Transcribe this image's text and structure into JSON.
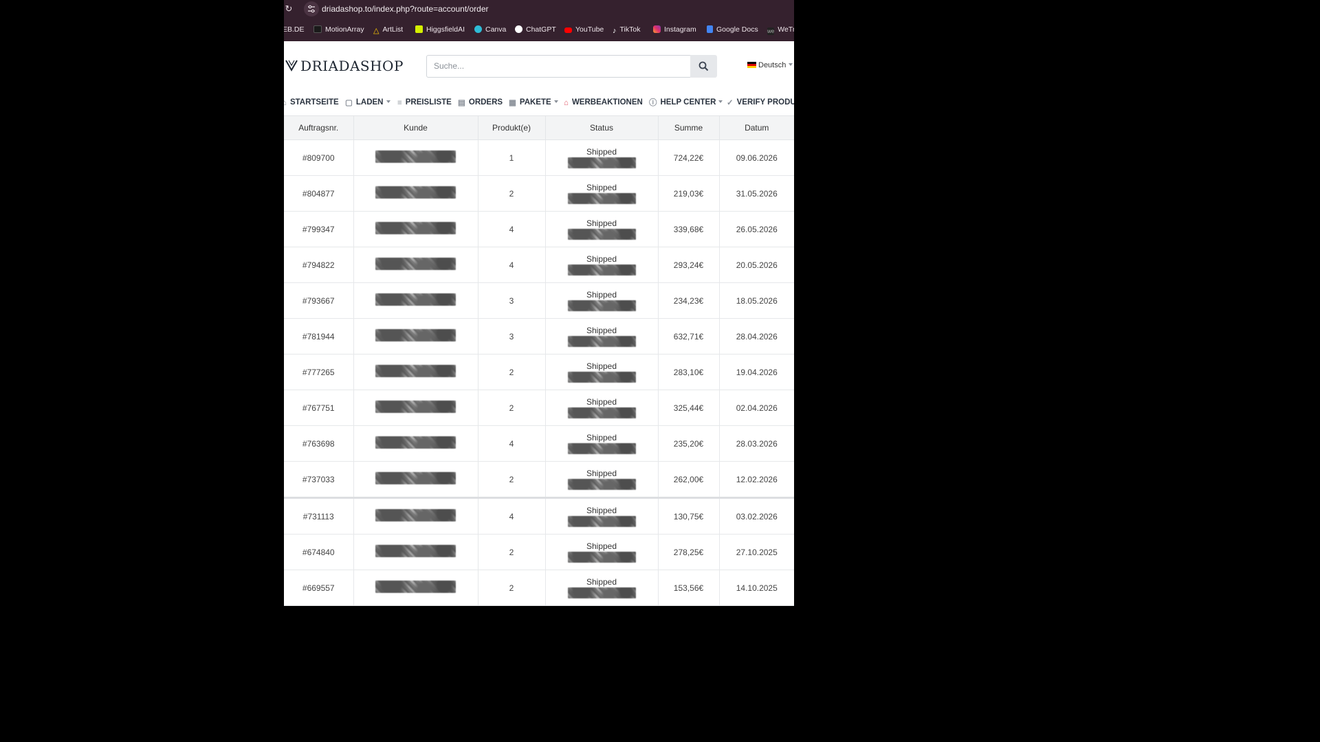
{
  "browser": {
    "url": "driadashop.to/index.php?route=account/order",
    "bookmarks": [
      {
        "label": "EB.DE",
        "icon": "none",
        "color": ""
      },
      {
        "label": "MotionArray",
        "icon": "motionarray-icon",
        "color": "#1a1a1a"
      },
      {
        "label": "ArtList",
        "icon": "artlist-icon",
        "color": "#ffcc00"
      },
      {
        "label": "HiggsfieldAI",
        "icon": "higgsfield-icon",
        "color": "#d4f000"
      },
      {
        "label": "Canva",
        "icon": "canva-icon",
        "color": "#2ebcd6"
      },
      {
        "label": "ChatGPT",
        "icon": "chatgpt-icon",
        "color": "#ffffff"
      },
      {
        "label": "YouTube",
        "icon": "youtube-icon",
        "color": "#ff0000"
      },
      {
        "label": "TikTok",
        "icon": "tiktok-icon",
        "color": "#000000"
      },
      {
        "label": "Instagram",
        "icon": "instagram-icon",
        "color": "#e1306c"
      },
      {
        "label": "Google Docs",
        "icon": "google-docs-icon",
        "color": "#4285f4"
      },
      {
        "label": "WeTr",
        "icon": "wetransfer-icon",
        "color": "#222222"
      }
    ]
  },
  "header": {
    "logo": "DRIADASHOP",
    "search_placeholder": "Suche...",
    "language": "Deutsch"
  },
  "nav": {
    "items": [
      {
        "label": "STARTSEITE",
        "icon": "home-icon",
        "dropdown": false
      },
      {
        "label": "LADEN",
        "icon": "shopping-bag-icon",
        "dropdown": true
      },
      {
        "label": "PREISLISTE",
        "icon": "list-icon",
        "dropdown": false
      },
      {
        "label": "ORDERS",
        "icon": "orders-icon",
        "dropdown": false
      },
      {
        "label": "PAKETE",
        "icon": "packages-icon",
        "dropdown": true
      },
      {
        "label": "WERBEAKTIONEN",
        "icon": "promotions-icon",
        "dropdown": false
      },
      {
        "label": "HELP CENTER",
        "icon": "help-icon",
        "dropdown": true
      },
      {
        "label": "VERIFY PRODUC",
        "icon": "check-icon",
        "dropdown": false
      }
    ]
  },
  "orders": {
    "columns": [
      "Auftragsnr.",
      "Kunde",
      "Produkt(e)",
      "Status",
      "Summe",
      "Datum"
    ],
    "rows": [
      {
        "id": "#809700",
        "products": "1",
        "status": "Shipped",
        "total": "724,22€",
        "date": "09.06.2026"
      },
      {
        "id": "#804877",
        "products": "2",
        "status": "Shipped",
        "total": "219,03€",
        "date": "31.05.2026"
      },
      {
        "id": "#799347",
        "products": "4",
        "status": "Shipped",
        "total": "339,68€",
        "date": "26.05.2026"
      },
      {
        "id": "#794822",
        "products": "4",
        "status": "Shipped",
        "total": "293,24€",
        "date": "20.05.2026"
      },
      {
        "id": "#793667",
        "products": "3",
        "status": "Shipped",
        "total": "234,23€",
        "date": "18.05.2026"
      },
      {
        "id": "#781944",
        "products": "3",
        "status": "Shipped",
        "total": "632,71€",
        "date": "28.04.2026"
      },
      {
        "id": "#777265",
        "products": "2",
        "status": "Shipped",
        "total": "283,10€",
        "date": "19.04.2026"
      },
      {
        "id": "#767751",
        "products": "2",
        "status": "Shipped",
        "total": "325,44€",
        "date": "02.04.2026"
      },
      {
        "id": "#763698",
        "products": "4",
        "status": "Shipped",
        "total": "235,20€",
        "date": "28.03.2026"
      },
      {
        "id": "#737033",
        "products": "2",
        "status": "Shipped",
        "total": "262,00€",
        "date": "12.02.2026"
      },
      {
        "id": "#731113",
        "products": "4",
        "status": "Shipped",
        "total": "130,75€",
        "date": "03.02.2026"
      },
      {
        "id": "#674840",
        "products": "2",
        "status": "Shipped",
        "total": "278,25€",
        "date": "27.10.2025"
      },
      {
        "id": "#669557",
        "products": "2",
        "status": "Shipped",
        "total": "153,56€",
        "date": "14.10.2025"
      }
    ]
  }
}
